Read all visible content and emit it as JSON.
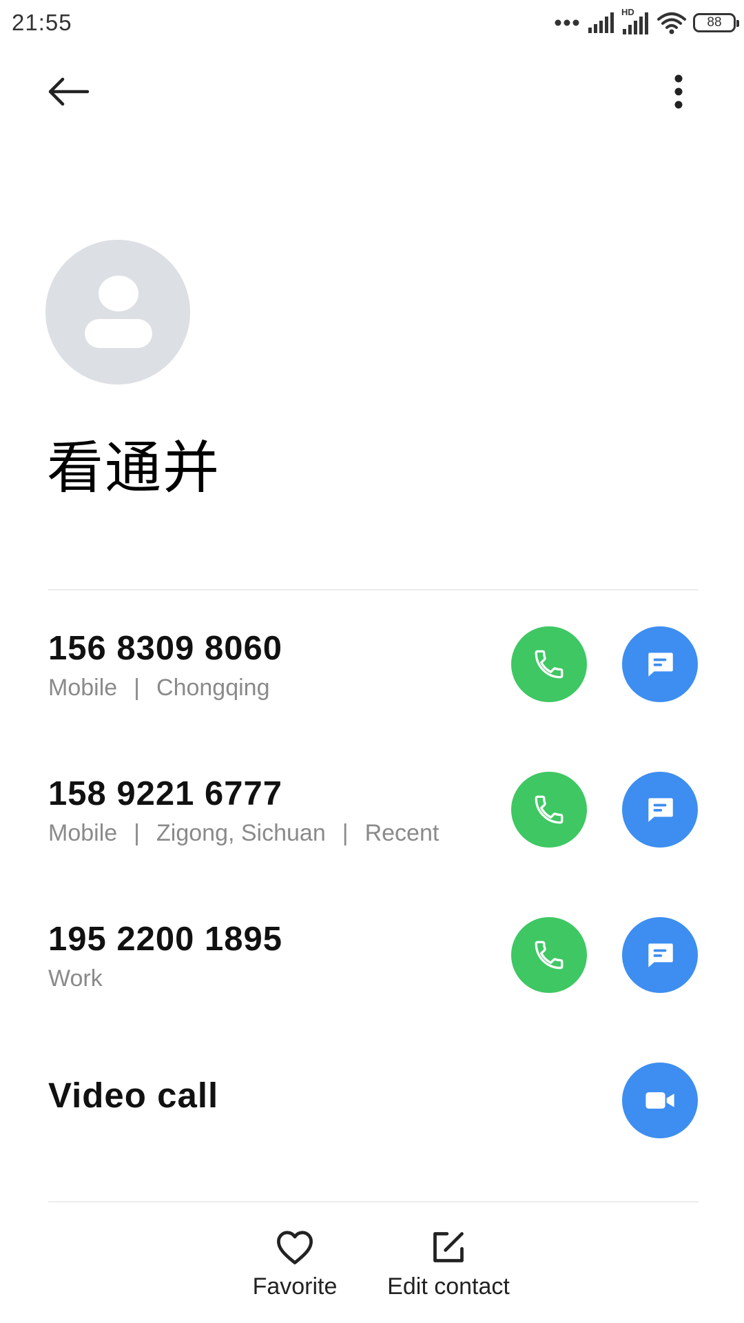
{
  "status_bar": {
    "time": "21:55",
    "battery": "88",
    "network_label": "HD",
    "icons": [
      "more-dots-icon",
      "signal-icon",
      "signal-hd-icon",
      "wifi-icon",
      "battery-icon"
    ]
  },
  "header": {
    "back_icon": "arrow-left-icon",
    "more_icon": "more-vertical-icon"
  },
  "contact": {
    "name": "看通并",
    "avatar_icon": "person-placeholder-icon"
  },
  "phones": [
    {
      "number": "156 8309 8060",
      "type": "Mobile",
      "location": "Chongqing",
      "extra": ""
    },
    {
      "number": "158 9221 6777",
      "type": "Mobile",
      "location": "Zigong, Sichuan",
      "extra": "Recent"
    },
    {
      "number": "195 2200 1895",
      "type": "Work",
      "location": "",
      "extra": ""
    }
  ],
  "meta_separator": "|",
  "video_call": {
    "label": "Video call",
    "icon": "video-camera-icon"
  },
  "bottom_bar": {
    "favorite_label": "Favorite",
    "favorite_icon": "heart-outline-icon",
    "edit_label": "Edit contact",
    "edit_icon": "edit-icon"
  },
  "colors": {
    "call_green": "#3ec763",
    "message_blue": "#3d8ef0",
    "avatar_gray": "#dcdfe4",
    "secondary_text": "#8a8a8a"
  }
}
